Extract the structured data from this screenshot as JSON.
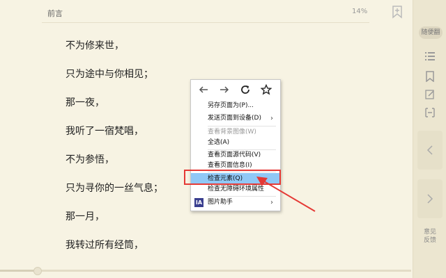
{
  "header": {
    "title": "前言",
    "progress": "14%",
    "bookmark_icon": "bookmark-add-icon"
  },
  "content": {
    "lines": [
      "不为修来世，",
      "只为途中与你相见；",
      "那一夜，",
      "我听了一宿梵唱，",
      "不为参悟，",
      "只为寻你的一丝气息；",
      "那一月，",
      "我转过所有经筒，"
    ]
  },
  "sidebar": {
    "notes_label": "随便翻",
    "icons": [
      "list-icon",
      "bookmark-icon",
      "edit-icon",
      "font-size-icon"
    ],
    "prev_icon": "chevron-left-icon",
    "next_icon": "chevron-right-icon",
    "feedback_label_1": "意见",
    "feedback_label_2": "反馈"
  },
  "context_menu": {
    "nav_icons": [
      "back-icon",
      "forward-icon",
      "reload-icon",
      "star-icon"
    ],
    "items": [
      {
        "label": "另存页面为(P)...",
        "disabled": false
      },
      {
        "label": "发送页面到设备(D)",
        "disabled": false,
        "submenu": true
      },
      {
        "label": "查看背景图像(W)",
        "disabled": true
      },
      {
        "label": "全选(A)",
        "disabled": false
      },
      {
        "label": "查看页面源代码(V)",
        "disabled": false
      },
      {
        "label": "查看页面信息(I)",
        "disabled": false
      },
      {
        "label": "检查元素(Q)",
        "disabled": false,
        "highlighted": true
      },
      {
        "label": "检查无障碍环境属性",
        "disabled": false
      },
      {
        "label": "图片助手",
        "disabled": false,
        "submenu": true,
        "icon": "IA"
      }
    ]
  },
  "reading_progress": 0.09,
  "colors": {
    "background": "#f7f3e3",
    "highlight": "#90c8f6",
    "annotation_red": "#e53935"
  }
}
